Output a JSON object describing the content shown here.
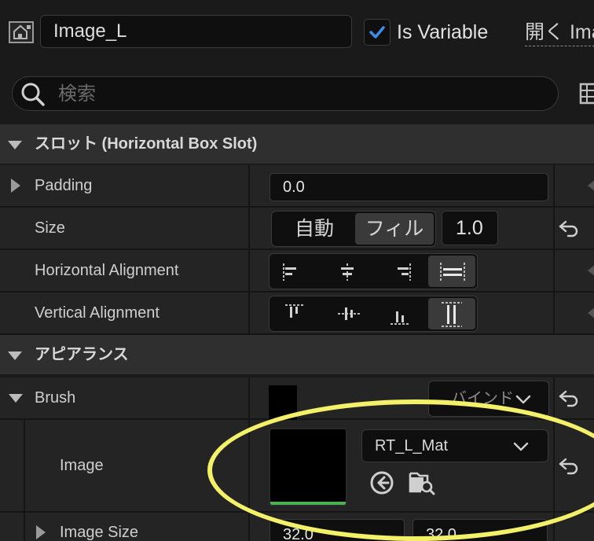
{
  "header": {
    "widget_name": "Image_L",
    "is_variable_label": "Is Variable",
    "is_variable_checked": true,
    "open_label": "開く Ima"
  },
  "search": {
    "placeholder": "検索"
  },
  "sections": {
    "slot": {
      "title": "スロット (Horizontal Box Slot)"
    },
    "appearance": {
      "title": "アピアランス"
    }
  },
  "rows": {
    "padding": {
      "label": "Padding",
      "value": "0.0"
    },
    "size": {
      "label": "Size",
      "options": [
        "自動",
        "フィル"
      ],
      "selected": "フィル",
      "value": "1.0"
    },
    "horizontal_alignment": {
      "label": "Horizontal Alignment",
      "selected_index": 3
    },
    "vertical_alignment": {
      "label": "Vertical Alignment",
      "selected_index": 3
    },
    "brush": {
      "label": "Brush",
      "bind_label": "バインド"
    },
    "image": {
      "label": "Image",
      "asset": "RT_L_Mat"
    },
    "image_size": {
      "label": "Image Size",
      "x": "32.0",
      "y": "32.0"
    }
  },
  "colors": {
    "checkbox_accent": "#3b8ee8",
    "highlight_ring": "#f3f06a",
    "thumbnail_bar": "#4caf50"
  }
}
